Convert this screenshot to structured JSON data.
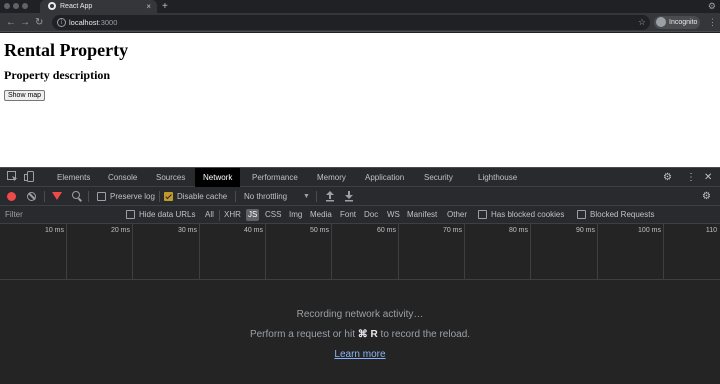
{
  "browser": {
    "tab_title": "React App",
    "tab_close": "×",
    "new_tab": "+",
    "url_host": "localhost",
    "url_port": ":3000",
    "incognito_label": "Incognito",
    "nav": {
      "back": "←",
      "forward": "→",
      "reload": "↻"
    },
    "star": "☆",
    "menu": "⋮",
    "gear": "⚙"
  },
  "page": {
    "title": "Rental Property",
    "subtitle": "Property description",
    "button_label": "Show map"
  },
  "devtools": {
    "tabs": [
      {
        "label": "Elements"
      },
      {
        "label": "Console"
      },
      {
        "label": "Sources"
      },
      {
        "label": "Network",
        "active": true
      },
      {
        "label": "Performance"
      },
      {
        "label": "Memory"
      },
      {
        "label": "Application"
      },
      {
        "label": "Security"
      },
      {
        "label": "Lighthouse"
      }
    ],
    "gear": "⚙",
    "menu": "⋮",
    "close": "✕",
    "toolbar": {
      "preserve_log": "Preserve log",
      "preserve_log_checked": false,
      "disable_cache": "Disable cache",
      "disable_cache_checked": true,
      "throttling": "No throttling",
      "caret": "▼",
      "import": "⇡",
      "export": "⇣"
    },
    "filterbar": {
      "filter_placeholder": "Filter",
      "hide_data_urls": "Hide data URLs",
      "types": [
        "All",
        "XHR",
        "JS",
        "CSS",
        "Img",
        "Media",
        "Font",
        "Doc",
        "WS",
        "Manifest",
        "Other"
      ],
      "selected_type": "JS",
      "has_blocked_cookies": "Has blocked cookies",
      "blocked_requests": "Blocked Requests"
    },
    "timeline_ticks": [
      "10 ms",
      "20 ms",
      "30 ms",
      "40 ms",
      "50 ms",
      "60 ms",
      "70 ms",
      "80 ms",
      "90 ms",
      "100 ms",
      "110"
    ],
    "empty": {
      "title": "Recording network activity…",
      "hint_prefix": "Perform a request or hit",
      "hint_keys": "⌘ R",
      "hint_suffix": "to record the reload.",
      "learn_more": "Learn more"
    },
    "colors": {
      "record": "#ee4a4a",
      "selected_type_bg": "#5f6368",
      "link": "#8ab4f8",
      "checked": "#c09a2a"
    }
  }
}
